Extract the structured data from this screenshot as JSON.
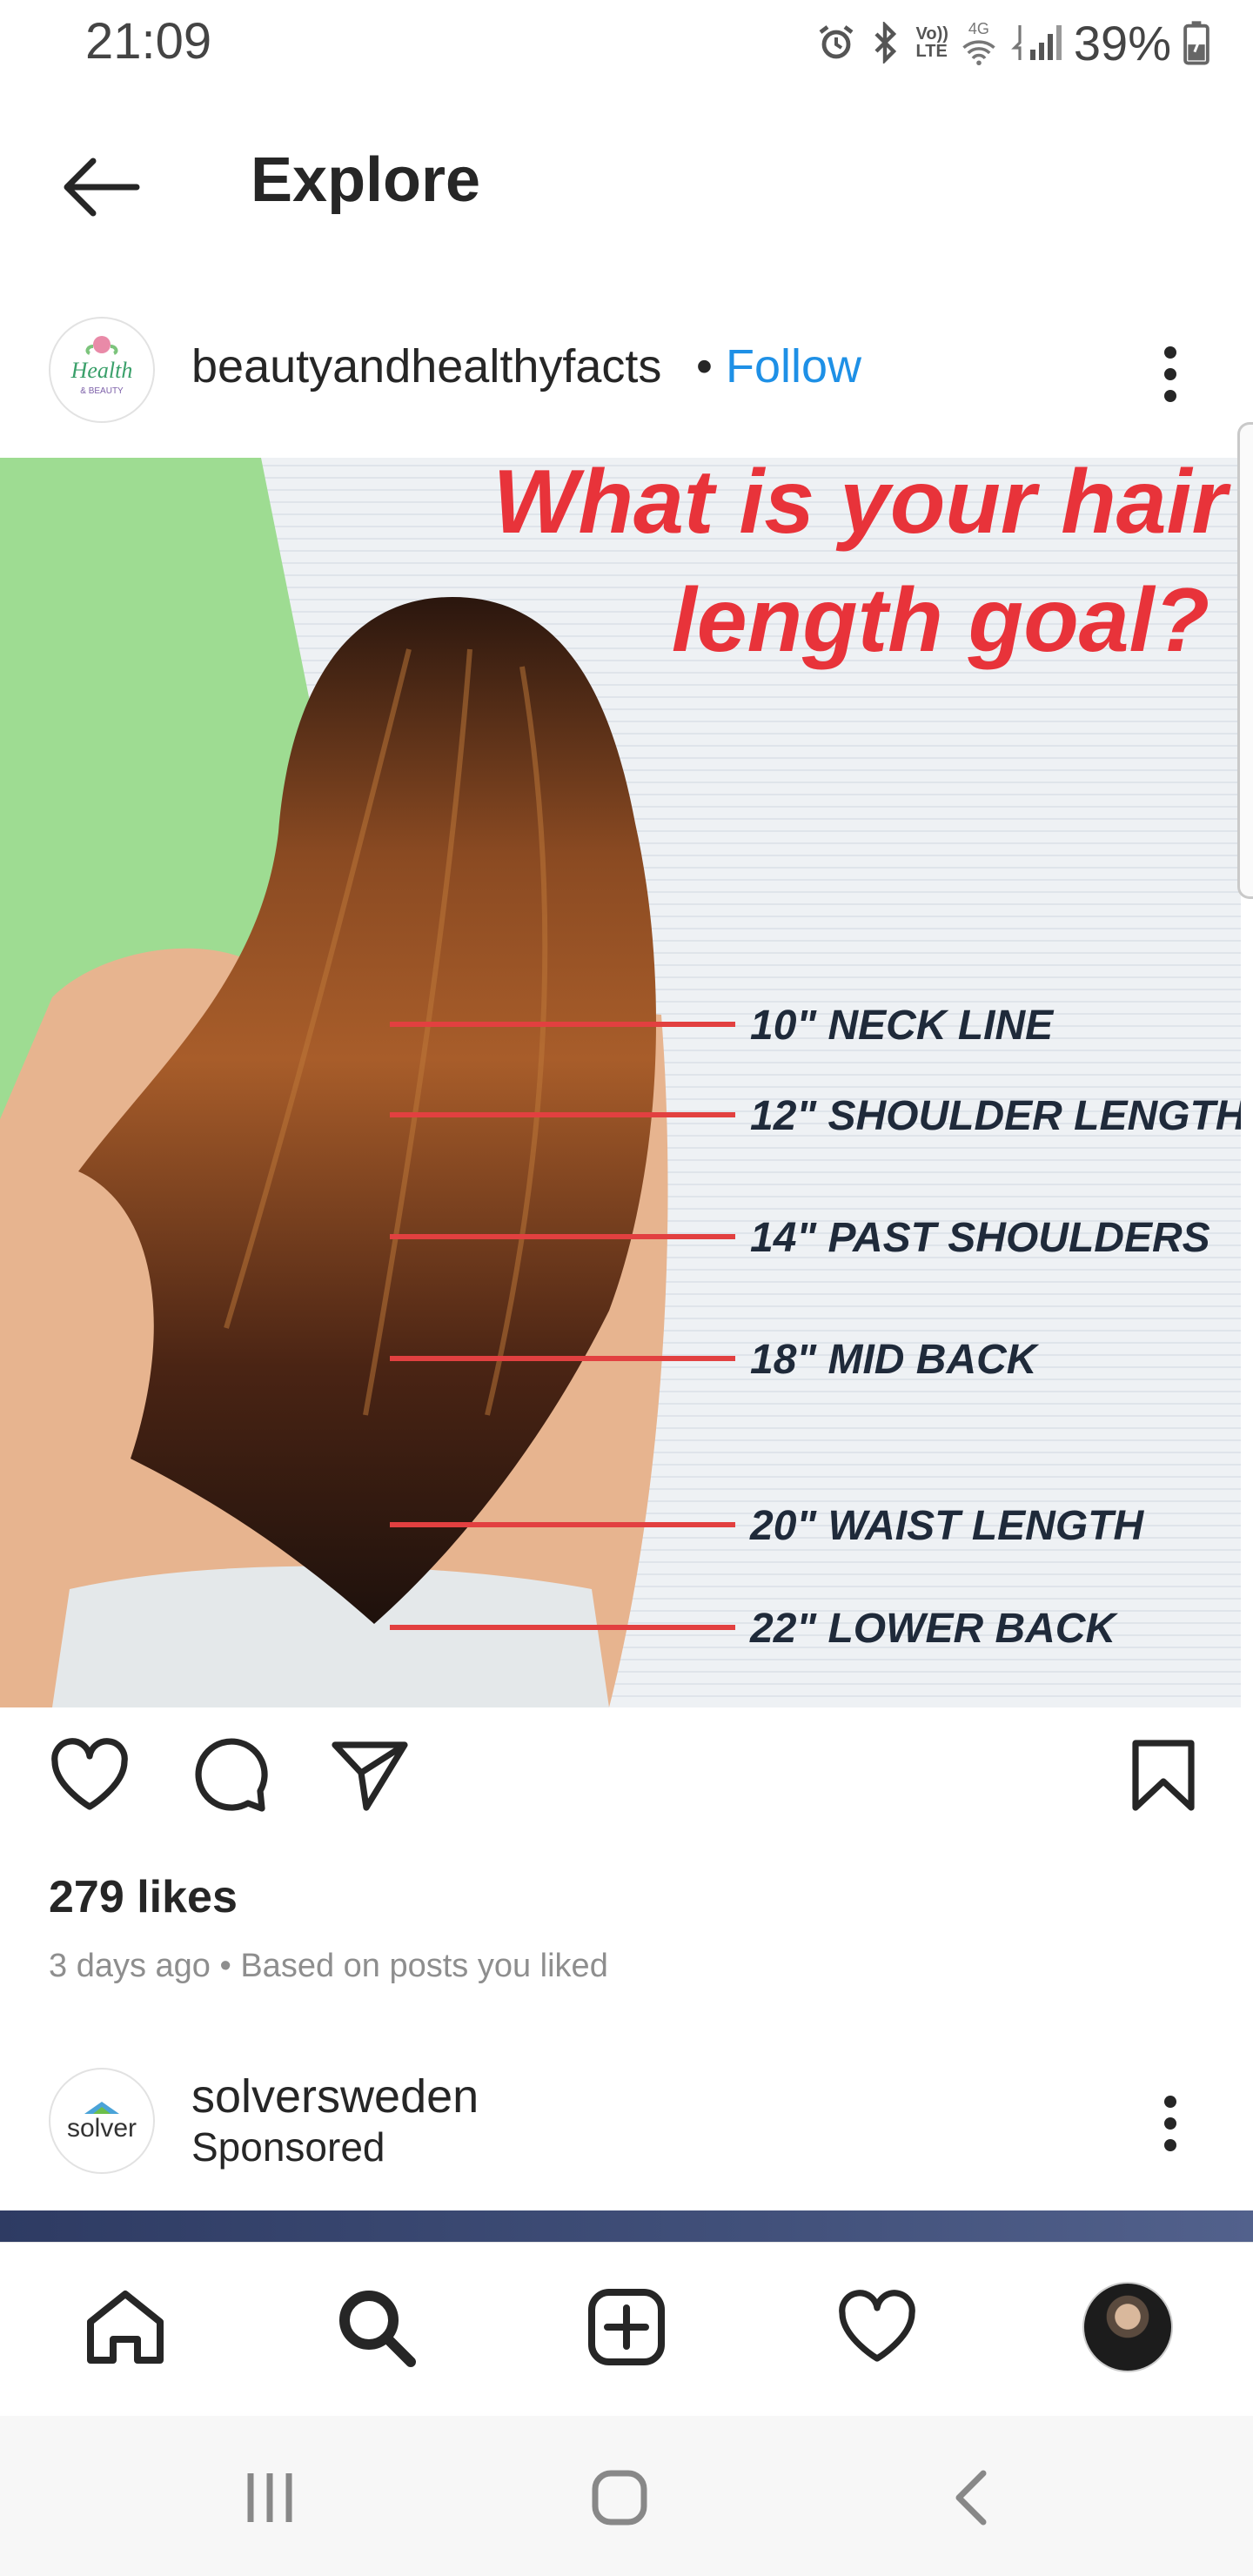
{
  "status_bar": {
    "time": "21:09",
    "network_label_top": "Vo))",
    "network_label_bottom": "LTE",
    "network_type": "4G",
    "battery": "39%",
    "icons": [
      "alarm-icon",
      "bluetooth-icon",
      "volte-icon",
      "wifi-icon",
      "signal-icon",
      "battery-icon"
    ]
  },
  "header": {
    "title": "Explore",
    "back_icon": "arrow-left-icon"
  },
  "post": {
    "avatar_text_line1": "Health",
    "avatar_text_line2": "& BEAUTY",
    "username": "beautyandhealthyfacts",
    "separator": "•",
    "follow_label": "Follow",
    "image": {
      "title_line1": "What is your hair",
      "title_line2": "length goal?",
      "markers": [
        "10\" NECK LINE",
        "12\" SHOULDER LENGTH",
        "14\" PAST SHOULDERS",
        "18\" MID BACK",
        "20\" WAIST LENGTH",
        "22\" LOWER BACK"
      ]
    },
    "likes": "279 likes",
    "meta": "3 days ago • Based on posts you liked"
  },
  "sponsored": {
    "avatar_text": "solver",
    "username": "solversweden",
    "label": "Sponsored"
  },
  "bottom_nav": {
    "items": [
      "home-icon",
      "search-icon",
      "add-post-icon",
      "activity-heart-icon",
      "profile-avatar"
    ]
  },
  "system_nav": {
    "items": [
      "recent-apps-icon",
      "home-button-icon",
      "back-chevron-icon"
    ]
  },
  "colors": {
    "accent": "#1e90e6",
    "title_red": "#e8333a",
    "marker_red": "#e24040",
    "green_bg": "#9edc92"
  }
}
